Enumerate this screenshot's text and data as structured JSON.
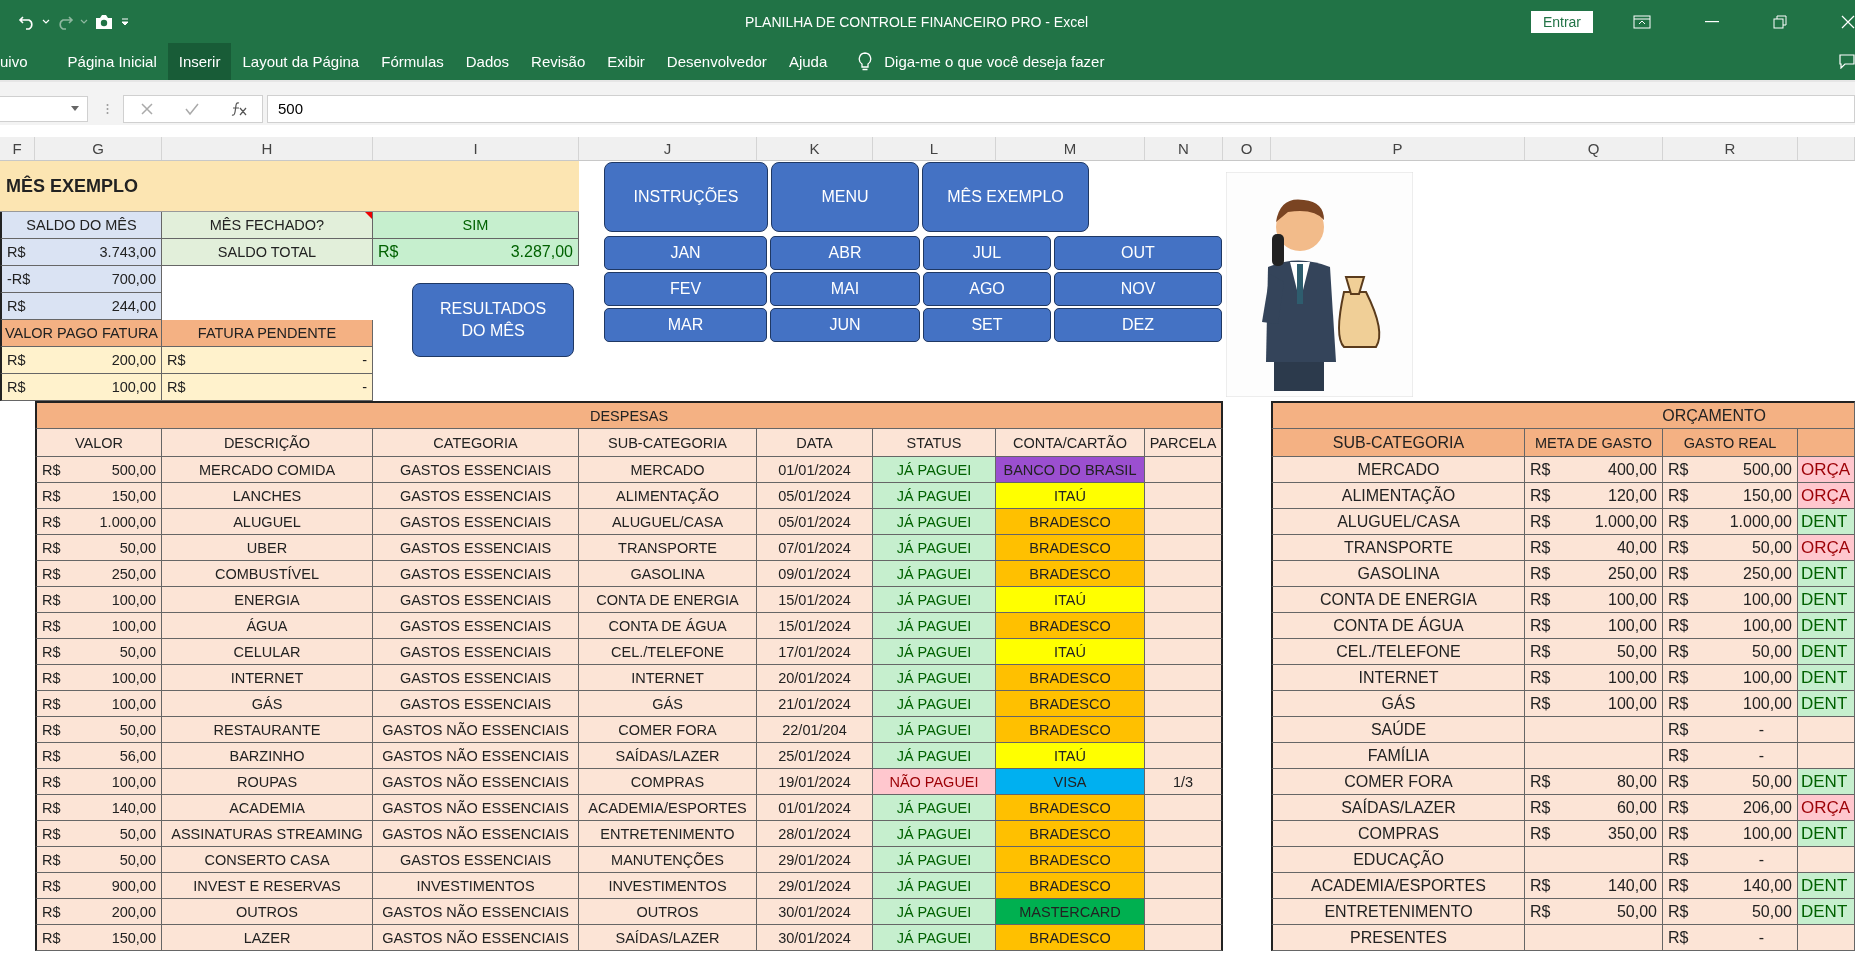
{
  "window": {
    "title": "PLANILHA DE CONTROLE FINANCEIRO PRO  -  Excel",
    "sign_in": "Entrar"
  },
  "ribbon_tabs": [
    {
      "label": "uivo",
      "selected": false
    },
    {
      "label": "Página Inicial",
      "selected": false
    },
    {
      "label": "Inserir",
      "selected": true
    },
    {
      "label": "Layout da Página",
      "selected": false
    },
    {
      "label": "Fórmulas",
      "selected": false
    },
    {
      "label": "Dados",
      "selected": false
    },
    {
      "label": "Revisão",
      "selected": false
    },
    {
      "label": "Exibir",
      "selected": false
    },
    {
      "label": "Desenvolvedor",
      "selected": false
    },
    {
      "label": "Ajuda",
      "selected": false
    }
  ],
  "tell_me": "Diga-me o que você deseja fazer",
  "formula_bar": {
    "value": "500"
  },
  "columns": [
    "F",
    "G",
    "H",
    "I",
    "J",
    "K",
    "L",
    "M",
    "N",
    "O",
    "P",
    "Q",
    "R"
  ],
  "summary": {
    "title": "MÊS EXEMPLO",
    "balance_header": "SALDO DO MÊS",
    "balances": [
      {
        "currency": "R$",
        "value": "3.743,00"
      },
      {
        "currency": "-R$",
        "value": "700,00"
      },
      {
        "currency": "R$",
        "value": "244,00"
      }
    ],
    "month_closed_label": "MÊS FECHADO?",
    "month_closed_value": "SIM",
    "total_label": "SALDO TOTAL",
    "total": {
      "currency": "R$",
      "value": "3.287,00"
    },
    "invoice_paid_header": "VALOR PAGO FATURA",
    "invoice_pending_header": "FATURA PENDENTE",
    "invoices": [
      {
        "paid_currency": "R$",
        "paid": "200,00",
        "pending_currency": "R$",
        "pending": "-"
      },
      {
        "paid_currency": "R$",
        "paid": "100,00",
        "pending_currency": "R$",
        "pending": "-"
      }
    ]
  },
  "nav_buttons": [
    "INSTRUÇÕES",
    "MENU",
    "MÊS EXEMPLO"
  ],
  "month_buttons": [
    "JAN",
    "ABR",
    "JUL",
    "OUT",
    "FEV",
    "MAI",
    "AGO",
    "NOV",
    "MAR",
    "JUN",
    "SET",
    "DEZ"
  ],
  "results_button": "RESULTADOS DO MÊS",
  "expenses": {
    "title": "DESPESAS",
    "columns": [
      "VALOR",
      "DESCRIÇÃO",
      "CATEGORIA",
      "SUB-CATEGORIA",
      "DATA",
      "STATUS",
      "CONTA/CARTÃO",
      "PARCELA"
    ],
    "rows": [
      {
        "currency": "R$",
        "value": "500,00",
        "description": "MERCADO COMIDA",
        "category": "GASTOS ESSENCIAIS",
        "subcategory": "MERCADO",
        "date": "01/01/2024",
        "status": "JÁ PAGUEI",
        "paid": true,
        "account": "BANCO DO BRASIL",
        "color": "#9b4fd0"
      },
      {
        "currency": "R$",
        "value": "150,00",
        "description": "LANCHES",
        "category": "GASTOS ESSENCIAIS",
        "subcategory": "ALIMENTAÇÃO",
        "date": "05/01/2024",
        "status": "JÁ PAGUEI",
        "paid": true,
        "account": "ITAÚ",
        "color": "#ffff00"
      },
      {
        "currency": "R$",
        "value": "1.000,00",
        "description": "ALUGUEL",
        "category": "GASTOS ESSENCIAIS",
        "subcategory": "ALUGUEL/CASA",
        "date": "05/01/2024",
        "status": "JÁ PAGUEI",
        "paid": true,
        "account": "BRADESCO",
        "color": "#ffc000"
      },
      {
        "currency": "R$",
        "value": "50,00",
        "description": "UBER",
        "category": "GASTOS ESSENCIAIS",
        "subcategory": "TRANSPORTE",
        "date": "07/01/2024",
        "status": "JÁ PAGUEI",
        "paid": true,
        "account": "BRADESCO",
        "color": "#ffc000"
      },
      {
        "currency": "R$",
        "value": "250,00",
        "description": "COMBUSTÍVEL",
        "category": "GASTOS ESSENCIAIS",
        "subcategory": "GASOLINA",
        "date": "09/01/2024",
        "status": "JÁ PAGUEI",
        "paid": true,
        "account": "BRADESCO",
        "color": "#ffc000"
      },
      {
        "currency": "R$",
        "value": "100,00",
        "description": "ENERGIA",
        "category": "GASTOS ESSENCIAIS",
        "subcategory": "CONTA DE ENERGIA",
        "date": "15/01/2024",
        "status": "JÁ PAGUEI",
        "paid": true,
        "account": "ITAÚ",
        "color": "#ffff00"
      },
      {
        "currency": "R$",
        "value": "100,00",
        "description": "ÁGUA",
        "category": "GASTOS ESSENCIAIS",
        "subcategory": "CONTA DE ÁGUA",
        "date": "15/01/2024",
        "status": "JÁ PAGUEI",
        "paid": true,
        "account": "BRADESCO",
        "color": "#ffc000"
      },
      {
        "currency": "R$",
        "value": "50,00",
        "description": "CELULAR",
        "category": "GASTOS ESSENCIAIS",
        "subcategory": "CEL./TELEFONE",
        "date": "17/01/2024",
        "status": "JÁ PAGUEI",
        "paid": true,
        "account": "ITAÚ",
        "color": "#ffff00"
      },
      {
        "currency": "R$",
        "value": "100,00",
        "description": "INTERNET",
        "category": "GASTOS ESSENCIAIS",
        "subcategory": "INTERNET",
        "date": "20/01/2024",
        "status": "JÁ PAGUEI",
        "paid": true,
        "account": "BRADESCO",
        "color": "#ffc000"
      },
      {
        "currency": "R$",
        "value": "100,00",
        "description": "GÁS",
        "category": "GASTOS ESSENCIAIS",
        "subcategory": "GÁS",
        "date": "21/01/2024",
        "status": "JÁ PAGUEI",
        "paid": true,
        "account": "BRADESCO",
        "color": "#ffc000"
      },
      {
        "currency": "R$",
        "value": "50,00",
        "description": "RESTAURANTE",
        "category": "GASTOS NÃO ESSENCIAIS",
        "subcategory": "COMER FORA",
        "date": "22/01/204",
        "status": "JÁ PAGUEI",
        "paid": true,
        "account": "BRADESCO",
        "color": "#ffc000"
      },
      {
        "currency": "R$",
        "value": "56,00",
        "description": "BARZINHO",
        "category": "GASTOS NÃO ESSENCIAIS",
        "subcategory": "SAÍDAS/LAZER",
        "date": "25/01/2024",
        "status": "JÁ PAGUEI",
        "paid": true,
        "account": "ITAÚ",
        "color": "#ffff00"
      },
      {
        "currency": "R$",
        "value": "100,00",
        "description": "ROUPAS",
        "category": "GASTOS NÃO ESSENCIAIS",
        "subcategory": "COMPRAS",
        "date": "19/01/2024",
        "status": "NÃO PAGUEI",
        "paid": false,
        "account": "VISA",
        "color": "#00b0f0",
        "installment": "1/3"
      },
      {
        "currency": "R$",
        "value": "140,00",
        "description": "ACADEMIA",
        "category": "GASTOS NÃO ESSENCIAIS",
        "subcategory": "ACADEMIA/ESPORTES",
        "date": "01/01/2024",
        "status": "JÁ PAGUEI",
        "paid": true,
        "account": "BRADESCO",
        "color": "#ffc000"
      },
      {
        "currency": "R$",
        "value": "50,00",
        "description": "ASSINATURAS STREAMING",
        "category": "GASTOS NÃO ESSENCIAIS",
        "subcategory": "ENTRETENIMENTO",
        "date": "28/01/2024",
        "status": "JÁ PAGUEI",
        "paid": true,
        "account": "BRADESCO",
        "color": "#ffc000"
      },
      {
        "currency": "R$",
        "value": "50,00",
        "description": "CONSERTO CASA",
        "category": "GASTOS ESSENCIAIS",
        "subcategory": "MANUTENÇÕES",
        "date": "29/01/2024",
        "status": "JÁ PAGUEI",
        "paid": true,
        "account": "BRADESCO",
        "color": "#ffc000"
      },
      {
        "currency": "R$",
        "value": "900,00",
        "description": "INVEST E RESERVAS",
        "category": "INVESTIMENTOS",
        "subcategory": "INVESTIMENTOS",
        "date": "29/01/2024",
        "status": "JÁ PAGUEI",
        "paid": true,
        "account": "BRADESCO",
        "color": "#ffc000"
      },
      {
        "currency": "R$",
        "value": "200,00",
        "description": "OUTROS",
        "category": "GASTOS NÃO ESSENCIAIS",
        "subcategory": "OUTROS",
        "date": "30/01/2024",
        "status": "JÁ PAGUEI",
        "paid": true,
        "account": "MASTERCARD",
        "color": "#00b050"
      },
      {
        "currency": "R$",
        "value": "150,00",
        "description": "LAZER",
        "category": "GASTOS NÃO ESSENCIAIS",
        "subcategory": "SAÍDAS/LAZER",
        "date": "30/01/2024",
        "status": "JÁ PAGUEI",
        "paid": true,
        "account": "BRADESCO",
        "color": "#ffc000"
      }
    ]
  },
  "budget": {
    "title": "ORÇAMENTO",
    "columns": [
      "SUB-CATEGORIA",
      "META DE GASTO",
      "GASTO REAL"
    ],
    "rows": [
      {
        "subcategory": "MERCADO",
        "goal_currency": "R$",
        "goal": "400,00",
        "real_currency": "R$",
        "real": "500,00",
        "status": "ORÇA",
        "kind": "over"
      },
      {
        "subcategory": "ALIMENTAÇÃO",
        "goal_currency": "R$",
        "goal": "120,00",
        "real_currency": "R$",
        "real": "150,00",
        "status": "ORÇA",
        "kind": "over"
      },
      {
        "subcategory": "ALUGUEL/CASA",
        "goal_currency": "R$",
        "goal": "1.000,00",
        "real_currency": "R$",
        "real": "1.000,00",
        "status": "DENT",
        "kind": "within"
      },
      {
        "subcategory": "TRANSPORTE",
        "goal_currency": "R$",
        "goal": "40,00",
        "real_currency": "R$",
        "real": "50,00",
        "status": "ORÇA",
        "kind": "over"
      },
      {
        "subcategory": "GASOLINA",
        "goal_currency": "R$",
        "goal": "250,00",
        "real_currency": "R$",
        "real": "250,00",
        "status": "DENT",
        "kind": "within"
      },
      {
        "subcategory": "CONTA DE ENERGIA",
        "goal_currency": "R$",
        "goal": "100,00",
        "real_currency": "R$",
        "real": "100,00",
        "status": "DENT",
        "kind": "within"
      },
      {
        "subcategory": "CONTA DE ÁGUA",
        "goal_currency": "R$",
        "goal": "100,00",
        "real_currency": "R$",
        "real": "100,00",
        "status": "DENT",
        "kind": "within"
      },
      {
        "subcategory": "CEL./TELEFONE",
        "goal_currency": "R$",
        "goal": "50,00",
        "real_currency": "R$",
        "real": "50,00",
        "status": "DENT",
        "kind": "within"
      },
      {
        "subcategory": "INTERNET",
        "goal_currency": "R$",
        "goal": "100,00",
        "real_currency": "R$",
        "real": "100,00",
        "status": "DENT",
        "kind": "within"
      },
      {
        "subcategory": "GÁS",
        "goal_currency": "R$",
        "goal": "100,00",
        "real_currency": "R$",
        "real": "100,00",
        "status": "DENT",
        "kind": "within"
      },
      {
        "subcategory": "SAÚDE",
        "real_currency": "R$",
        "real": "-"
      },
      {
        "subcategory": "FAMÍLIA",
        "real_currency": "R$",
        "real": "-"
      },
      {
        "subcategory": "COMER FORA",
        "goal_currency": "R$",
        "goal": "80,00",
        "real_currency": "R$",
        "real": "50,00",
        "status": "DENT",
        "kind": "within"
      },
      {
        "subcategory": "SAÍDAS/LAZER",
        "goal_currency": "R$",
        "goal": "60,00",
        "real_currency": "R$",
        "real": "206,00",
        "status": "ORÇA",
        "kind": "over"
      },
      {
        "subcategory": "COMPRAS",
        "goal_currency": "R$",
        "goal": "350,00",
        "real_currency": "R$",
        "real": "100,00",
        "status": "DENT",
        "kind": "within"
      },
      {
        "subcategory": "EDUCAÇÃO",
        "real_currency": "R$",
        "real": "-"
      },
      {
        "subcategory": "ACADEMIA/ESPORTES",
        "goal_currency": "R$",
        "goal": "140,00",
        "real_currency": "R$",
        "real": "140,00",
        "status": "DENT",
        "kind": "within"
      },
      {
        "subcategory": "ENTRETENIMENTO",
        "goal_currency": "R$",
        "goal": "50,00",
        "real_currency": "R$",
        "real": "50,00",
        "status": "DENT",
        "kind": "within"
      },
      {
        "subcategory": "PRESENTES",
        "real_currency": "R$",
        "real": "-"
      }
    ]
  }
}
